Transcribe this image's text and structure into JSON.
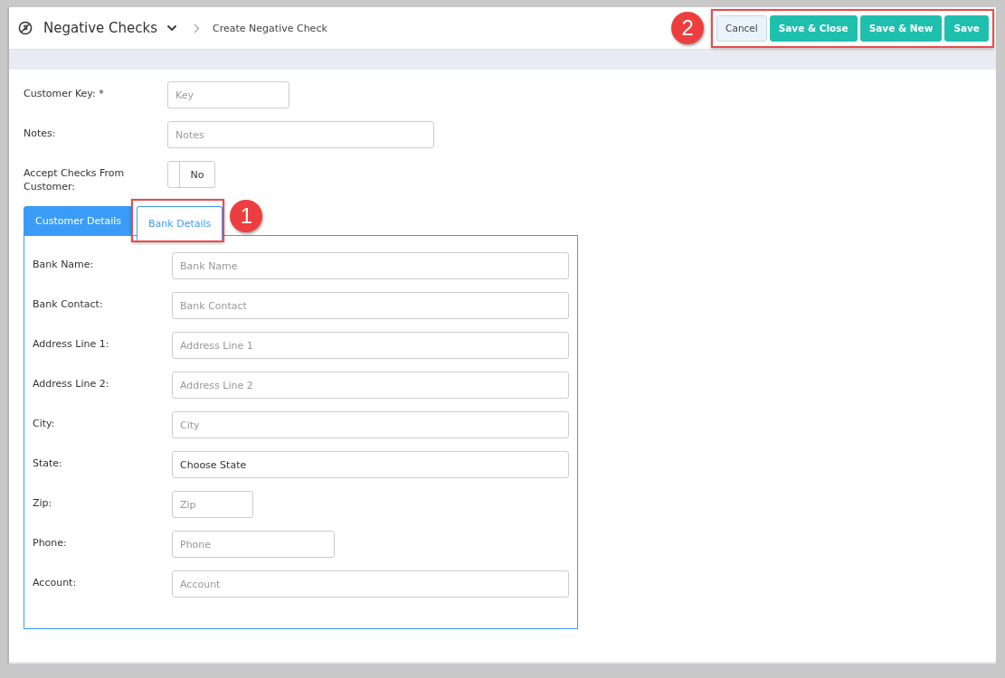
{
  "header": {
    "module": "Negative Checks",
    "breadcrumb": "Create Negative Check",
    "buttons": [
      {
        "label": "Cancel",
        "kind": "secondary"
      },
      {
        "label": "Save & Close",
        "kind": "primary"
      },
      {
        "label": "Save & New",
        "kind": "primary"
      },
      {
        "label": "Save",
        "kind": "primary"
      }
    ],
    "callout": "2"
  },
  "form": {
    "fields": [
      {
        "label": "Customer Key: *",
        "kind": "input",
        "placeholder": "Key"
      },
      {
        "label": "Notes:",
        "kind": "input",
        "placeholder": "Notes"
      },
      {
        "label": "Accept Checks From Customer:",
        "kind": "toggle",
        "value": "No",
        "on": false
      }
    ]
  },
  "tabs": [
    {
      "label": "Customer Details",
      "selected": false
    },
    {
      "label": "Bank Details",
      "selected": true,
      "callout": "1"
    }
  ],
  "bank_fields": [
    {
      "label": "Bank Name:",
      "kind": "input",
      "placeholder": "Bank Name"
    },
    {
      "label": "Bank Contact:",
      "kind": "input",
      "placeholder": "Bank Contact"
    },
    {
      "label": "Address Line 1:",
      "kind": "input",
      "placeholder": "Address Line 1"
    },
    {
      "label": "Address Line 2:",
      "kind": "input",
      "placeholder": "Address Line 2"
    },
    {
      "label": "City:",
      "kind": "input",
      "placeholder": "City"
    },
    {
      "label": "State:",
      "kind": "select",
      "value": "Choose State"
    },
    {
      "label": "Zip:",
      "kind": "input",
      "placeholder": "Zip"
    },
    {
      "label": "Phone:",
      "kind": "input",
      "placeholder": "Phone"
    },
    {
      "label": "Account:",
      "kind": "input",
      "placeholder": "Account"
    }
  ]
}
